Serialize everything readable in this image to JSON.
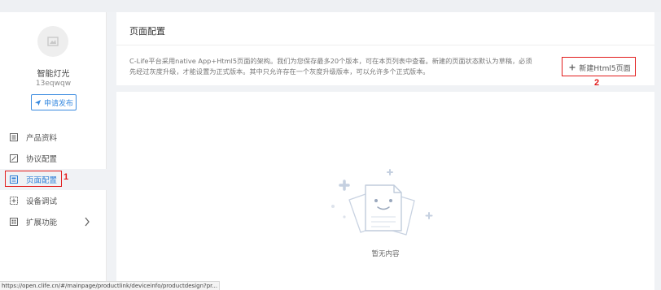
{
  "sidebar": {
    "product_name": "智能灯光",
    "product_id": "13eqwqw",
    "apply_button": "申请发布",
    "menu": [
      {
        "label": "产品资料",
        "icon": "document-list-icon"
      },
      {
        "label": "协议配置",
        "icon": "edit-icon"
      },
      {
        "label": "页面配置",
        "icon": "page-icon",
        "active": true
      },
      {
        "label": "设备调试",
        "icon": "debug-icon"
      },
      {
        "label": "扩展功能",
        "icon": "grid-icon"
      }
    ]
  },
  "header": {
    "title": "页面配置",
    "description": "C-Life平台采用native App+Html5页面的架构。我们为您保存最多20个版本，可在本页列表中查看。新建的页面状态默认为草稿，必须先经过灰度升级，才能设置为正式版本。其中只允许存在一个灰度升级版本，可以允许多个正式版本。",
    "new_button": "新建Html5页面"
  },
  "content": {
    "empty_text": "暂无内容"
  },
  "annotations": {
    "mark_1": "1",
    "mark_2": "2"
  },
  "status_url": "https://open.clife.cn/#/mainpage/productlink/deviceinfo/productdesign?pr...",
  "colors": {
    "accent": "#3a8be0",
    "highlight": "#e21b1b",
    "active_bg": "#f0f2f5"
  }
}
